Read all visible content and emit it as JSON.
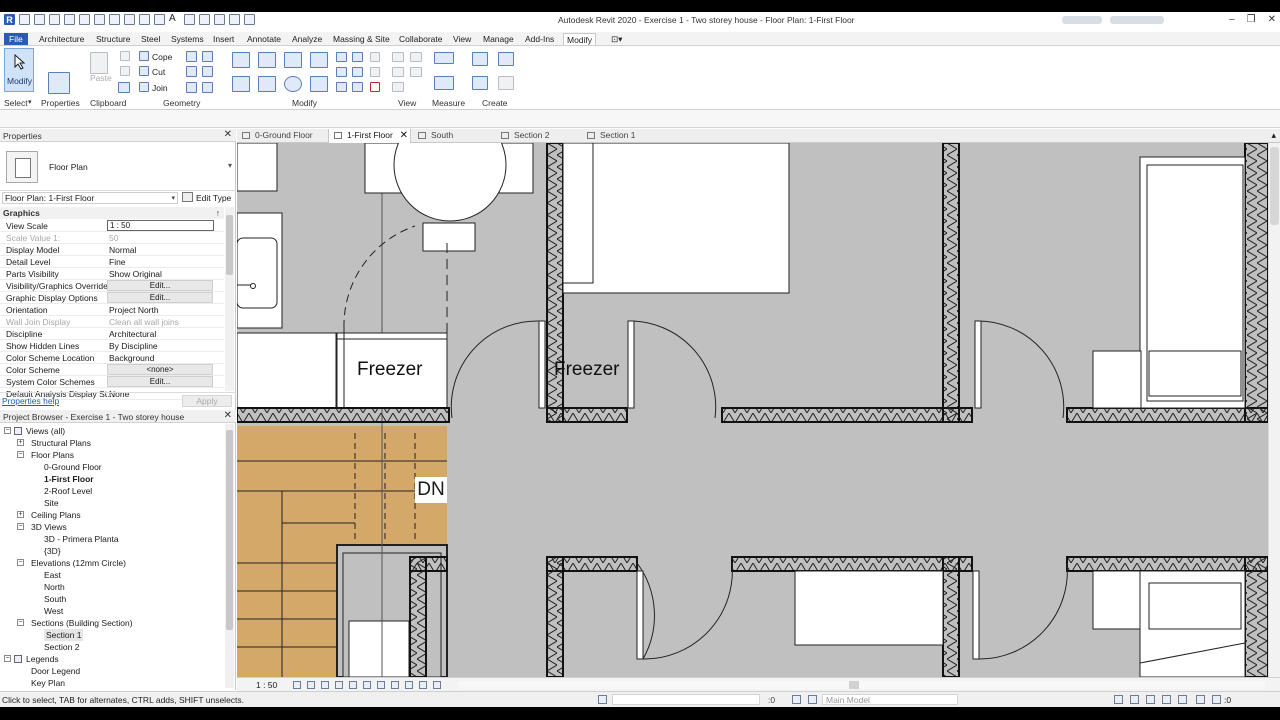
{
  "window": {
    "title": "Autodesk Revit 2020 - Exercise 1 - Two storey house - Floor Plan: 1-First Floor",
    "logo_letter": "R",
    "text_tool": "A",
    "minimize": "–",
    "restore": "❐",
    "close": "✕"
  },
  "ribbon_tabs": [
    "File",
    "Architecture",
    "Structure",
    "Steel",
    "Systems",
    "Insert",
    "Annotate",
    "Analyze",
    "Massing & Site",
    "Collaborate",
    "View",
    "Manage",
    "Add-Ins",
    "Modify"
  ],
  "ribbon_active_tab": "Modify",
  "ribbon": {
    "modify_label": "Modify",
    "select_label": "Select",
    "select_dropdown": "▾",
    "properties_label": "Properties",
    "clipboard_label": "Clipboard",
    "paste_label": "Paste",
    "cope_label": "Cope",
    "cut_label": "Cut",
    "join_label": "Join",
    "geometry_label": "Geometry",
    "modify_panel_label": "Modify",
    "view_label": "View",
    "measure_label": "Measure",
    "create_label": "Create"
  },
  "properties": {
    "header": "Properties",
    "close": "✕",
    "type_name": "Floor Plan",
    "instance": "Floor Plan: 1-First Floor",
    "edit_type": "Edit Type",
    "group": "Graphics",
    "group_toggle": "↑",
    "rows": [
      {
        "k": "View Scale",
        "v": "1 : 50",
        "kind": "input"
      },
      {
        "k": "Scale Value    1:",
        "v": "50",
        "kind": "dim"
      },
      {
        "k": "Display Model",
        "v": "Normal",
        "kind": "text"
      },
      {
        "k": "Detail Level",
        "v": "Fine",
        "kind": "text"
      },
      {
        "k": "Parts Visibility",
        "v": "Show Original",
        "kind": "text"
      },
      {
        "k": "Visibility/Graphics Overrides",
        "v": "Edit...",
        "kind": "button"
      },
      {
        "k": "Graphic Display Options",
        "v": "Edit...",
        "kind": "button"
      },
      {
        "k": "Orientation",
        "v": "Project North",
        "kind": "text"
      },
      {
        "k": "Wall Join Display",
        "v": "Clean all wall joins",
        "kind": "dim"
      },
      {
        "k": "Discipline",
        "v": "Architectural",
        "kind": "text"
      },
      {
        "k": "Show Hidden Lines",
        "v": "By Discipline",
        "kind": "text"
      },
      {
        "k": "Color Scheme Location",
        "v": "Background",
        "kind": "text"
      },
      {
        "k": "Color Scheme",
        "v": "<none>",
        "kind": "button"
      },
      {
        "k": "System Color Schemes",
        "v": "Edit...",
        "kind": "button"
      },
      {
        "k": "Default Analysis Display St...",
        "v": "None",
        "kind": "text"
      }
    ],
    "help_link": "Properties help",
    "apply": "Apply"
  },
  "browser": {
    "header": "Project Browser - Exercise 1 - Two storey house",
    "close": "✕",
    "items": [
      {
        "label": "Views (all)",
        "level": 0,
        "exp": "-",
        "icon": true
      },
      {
        "label": "Structural Plans",
        "level": 1,
        "exp": "+"
      },
      {
        "label": "Floor Plans",
        "level": 1,
        "exp": "-"
      },
      {
        "label": "0-Ground Floor",
        "level": 2
      },
      {
        "label": "1-First Floor",
        "level": 2,
        "bold": true
      },
      {
        "label": "2-Roof Level",
        "level": 2
      },
      {
        "label": "Site",
        "level": 2
      },
      {
        "label": "Ceiling Plans",
        "level": 1,
        "exp": "+"
      },
      {
        "label": "3D Views",
        "level": 1,
        "exp": "-"
      },
      {
        "label": "3D - Primera Planta",
        "level": 2
      },
      {
        "label": "{3D}",
        "level": 2
      },
      {
        "label": "Elevations (12mm Circle)",
        "level": 1,
        "exp": "-"
      },
      {
        "label": "East",
        "level": 2
      },
      {
        "label": "North",
        "level": 2
      },
      {
        "label": "South",
        "level": 2
      },
      {
        "label": "West",
        "level": 2
      },
      {
        "label": "Sections (Building Section)",
        "level": 1,
        "exp": "-"
      },
      {
        "label": "Section 1",
        "level": 2,
        "sel": true
      },
      {
        "label": "Section 2",
        "level": 2
      },
      {
        "label": "Legends",
        "level": 0,
        "exp": "-",
        "icon": true
      },
      {
        "label": "Door Legend",
        "level": 1
      },
      {
        "label": "Key Plan",
        "level": 1
      }
    ]
  },
  "view_tabs": [
    {
      "label": "0-Ground Floor",
      "active": false
    },
    {
      "label": "1-First Floor",
      "active": true,
      "close": "✕"
    },
    {
      "label": "South",
      "active": false
    },
    {
      "label": "Section 2",
      "active": false
    },
    {
      "label": "Section 1",
      "active": false
    }
  ],
  "canvas": {
    "room_label_1": "Freezer",
    "room_label_2": "Freezer",
    "stair_label": "DN"
  },
  "view_control": {
    "scale": "1 : 50"
  },
  "status": {
    "message": "Click to select, TAB for alternates, CTRL adds, SHIFT unselects.",
    "workset_count": ":0",
    "model": "Main Model",
    "filter_count": ":0"
  }
}
